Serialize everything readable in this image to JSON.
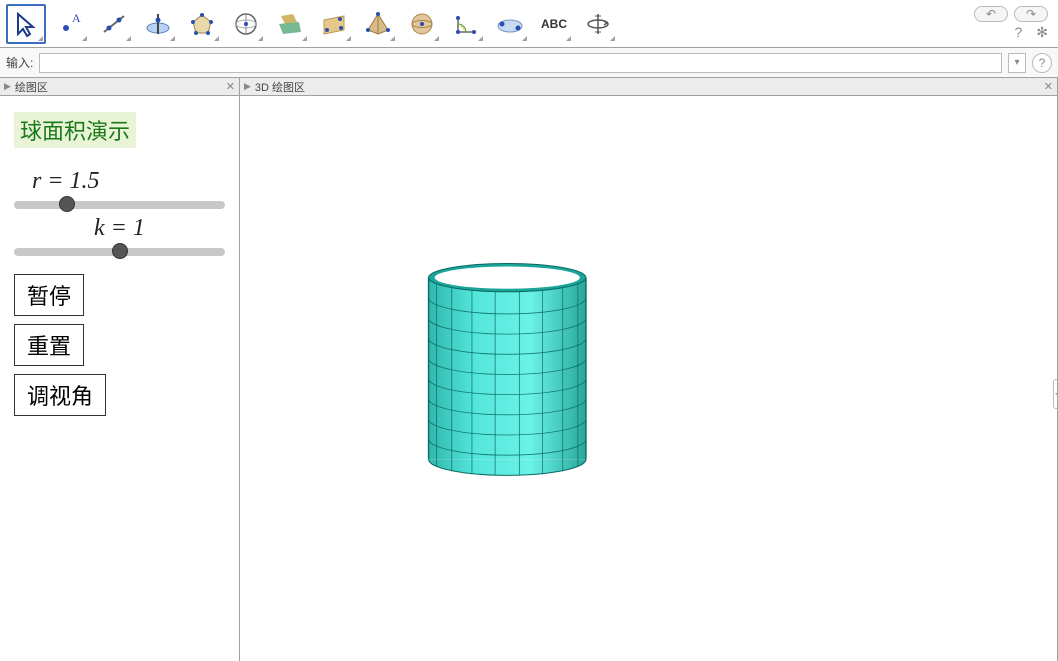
{
  "toolbar": {
    "tools": [
      {
        "name": "move-tool",
        "icon": "cursor",
        "selected": true
      },
      {
        "name": "point-tool",
        "icon": "point"
      },
      {
        "name": "line-tool",
        "icon": "line"
      },
      {
        "name": "perp-tool",
        "icon": "perp"
      },
      {
        "name": "polygon-tool",
        "icon": "poly"
      },
      {
        "name": "circle-tool",
        "icon": "circle3d"
      },
      {
        "name": "intersect-tool",
        "icon": "intersect"
      },
      {
        "name": "plane-tool",
        "icon": "plane"
      },
      {
        "name": "pyramid-tool",
        "icon": "pyramid"
      },
      {
        "name": "sphere-tool",
        "icon": "sphere"
      },
      {
        "name": "angle-tool",
        "icon": "angle"
      },
      {
        "name": "reflect-tool",
        "icon": "reflect"
      },
      {
        "name": "text-tool",
        "icon": "text",
        "label": "ABC"
      },
      {
        "name": "rotate-view-tool",
        "icon": "rotate3d"
      }
    ],
    "undo_glyph": "↶",
    "redo_glyph": "↷",
    "help_glyph": "?",
    "gear_glyph": "✻"
  },
  "inputbar": {
    "label": "输入:",
    "value": "",
    "selector_glyph": "▾",
    "help_glyph": "?"
  },
  "panels": {
    "left": {
      "title": "绘图区"
    },
    "right": {
      "title": "3D 绘图区"
    }
  },
  "demo": {
    "title": "球面积演示",
    "sliders": {
      "r": {
        "label": "r = 1.5",
        "pos_percent": 25
      },
      "k": {
        "label": "k = 1",
        "pos_percent": 50
      }
    },
    "buttons": {
      "pause": "暂停",
      "reset": "重置",
      "view": "调视角"
    }
  },
  "cylinder": {
    "color": "#40e0d0",
    "rows": 9,
    "cols": 16
  }
}
